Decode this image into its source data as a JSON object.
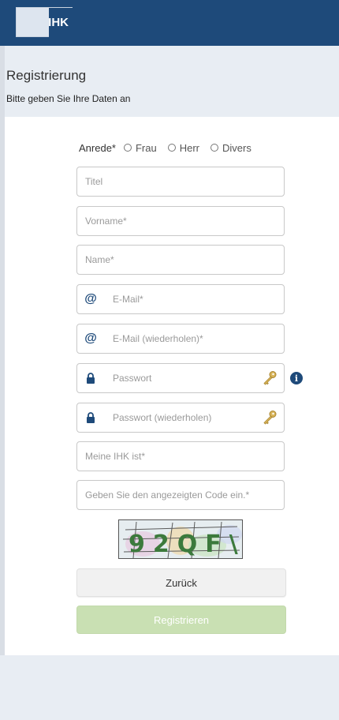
{
  "header": {
    "logo_text": "IHK",
    "brand_color": "#1e4a7a"
  },
  "page": {
    "title": "Registrierung",
    "subtitle": "Bitte geben Sie Ihre Daten an"
  },
  "form": {
    "anrede": {
      "label": "Anrede*",
      "options": [
        "Frau",
        "Herr",
        "Divers"
      ]
    },
    "fields": {
      "titel": {
        "placeholder": "Titel",
        "value": ""
      },
      "vorname": {
        "placeholder": "Vorname*",
        "value": ""
      },
      "name": {
        "placeholder": "Name*",
        "value": ""
      },
      "email": {
        "placeholder": "E-Mail*",
        "value": "",
        "icon": "at-icon"
      },
      "email_repeat": {
        "placeholder": "E-Mail (wiederholen)*",
        "value": "",
        "icon": "at-icon"
      },
      "password": {
        "placeholder": "Passwort",
        "value": "",
        "icon": "lock-icon"
      },
      "password_repeat": {
        "placeholder": "Passwort (wiederholen)",
        "value": "",
        "icon": "lock-icon"
      },
      "ihk": {
        "placeholder": "Meine IHK ist*",
        "value": ""
      },
      "captcha_code": {
        "placeholder": "Geben Sie den angezeigten Code ein.*",
        "value": ""
      }
    },
    "captcha_text": "92QF\\",
    "buttons": {
      "back": "Zurück",
      "register": "Registrieren"
    },
    "colors": {
      "register_disabled": "#c9e0b3",
      "key_gold": "#c9a54a"
    }
  }
}
